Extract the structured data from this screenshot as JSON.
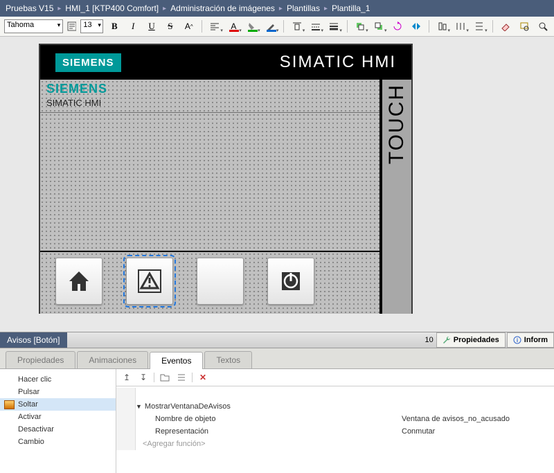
{
  "breadcrumb": [
    "Pruebas V15",
    "HMI_1 [KTP400 Comfort]",
    "Administración de imágenes",
    "Plantillas",
    "Plantilla_1"
  ],
  "toolbar": {
    "font": "Tahoma",
    "size": "13",
    "icon_labels": {
      "bold": "B",
      "italic": "I",
      "underline": "U",
      "strike": "S",
      "super": "A"
    }
  },
  "device": {
    "brand": "SIEMENS",
    "product": "SIMATIC HMI",
    "sub_brand": "SIEMENS",
    "sub_product": "SIMATIC HMI",
    "touch": "TOUCH"
  },
  "inspector": {
    "title": "Avisos [Botón]",
    "right_tabs": {
      "properties": "Propiedades",
      "info": "Inform"
    },
    "tabs": [
      "Propiedades",
      "Animaciones",
      "Eventos",
      "Textos"
    ],
    "active_tab": 2,
    "events_left": [
      "Hacer clic",
      "Pulsar",
      "Soltar",
      "Activar",
      "Desactivar",
      "Cambio"
    ],
    "events_sel": 2,
    "func_header": "MostrarVentanaDeAvisos",
    "func_rows": [
      {
        "label": "Nombre de objeto",
        "value": "Ventana de avisos_no_acusado"
      },
      {
        "label": "Representación",
        "value": "Conmutar"
      }
    ],
    "add_func": "<Agregar función>"
  },
  "percent": "10"
}
